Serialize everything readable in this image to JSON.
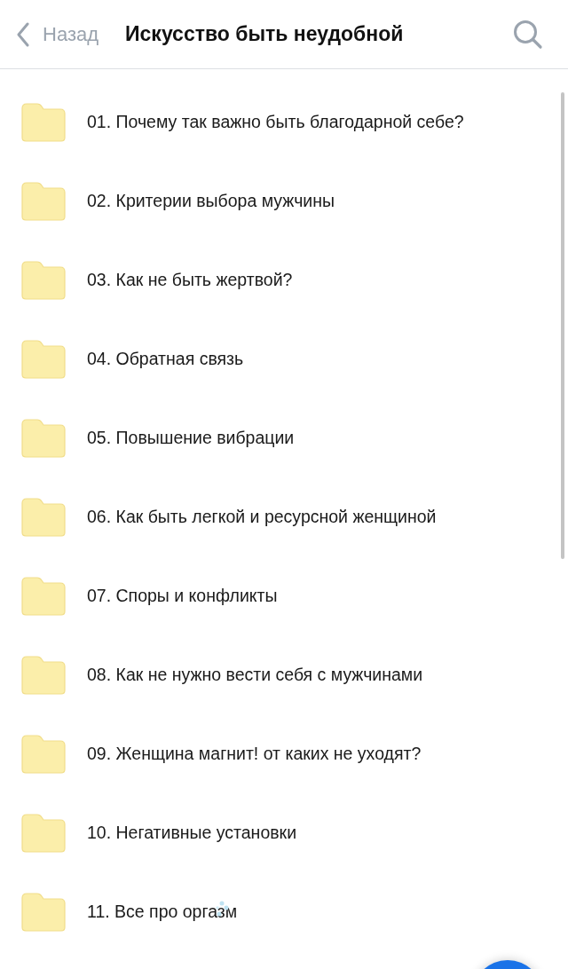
{
  "header": {
    "back_label": "Назад",
    "title": "Искусство быть неудобной"
  },
  "folders": [
    {
      "name": "01. Почему так важно быть благодарной себе?"
    },
    {
      "name": "02. Критерии выбора мужчины"
    },
    {
      "name": "03. Как не быть жертвой?"
    },
    {
      "name": "04. Обратная связь"
    },
    {
      "name": "05. Повышение вибрации"
    },
    {
      "name": "06. Как быть легкой и ресурсной женщиной"
    },
    {
      "name": "07. Споры и конфликты"
    },
    {
      "name": "08. Как не нужно вести себя с мужчинами"
    },
    {
      "name": "09. Женщина магнит! от каких не уходят?"
    },
    {
      "name": "10. Негативные установки"
    },
    {
      "name": "11. Все про оргазм",
      "loading": true
    }
  ]
}
